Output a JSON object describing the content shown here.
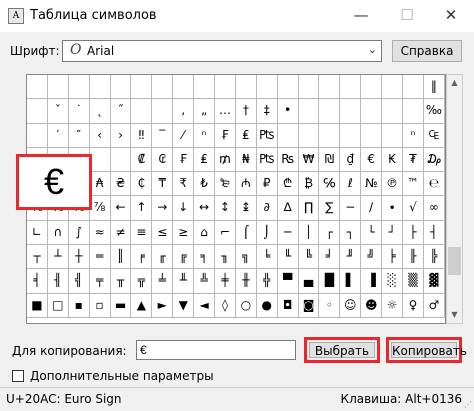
{
  "window": {
    "title": "Таблица символов",
    "app_icon": "char-map-icon",
    "minimize_icon": "—",
    "maximize_icon": "☐",
    "close_icon": "✕"
  },
  "font_row": {
    "label": "Шрифт:",
    "selected_font": "Arial",
    "font_type_icon": "O",
    "help_label": "Справка"
  },
  "grid": {
    "columns": 20,
    "rows": [
      [
        "",
        "",
        "",
        "",
        "",
        "",
        "",
        "",
        "",
        "",
        "",
        "",
        "",
        "",
        "",
        "",
        "",
        "",
        "",
        "‖"
      ],
      [
        "",
        "ˇ",
        "˙",
        "˛",
        "˝",
        "",
        "",
        "‚",
        "„",
        "…",
        "†",
        "‡",
        "•",
        "",
        "",
        "",
        "",
        "",
        "",
        "‰"
      ],
      [
        "",
        "′",
        "″",
        "‹",
        "›",
        "‼",
        "‾",
        "⁄",
        "ⁿ",
        "₣",
        "₤",
        "₧",
        "",
        "",
        "",
        "",
        "",
        "",
        "ⁿ",
        "₠"
      ],
      [
        "",
        "",
        "",
        "",
        "",
        "₡",
        "₢",
        "₣",
        "₤",
        "₥",
        "₦",
        "₧",
        "₨",
        "₩",
        "₪",
        "₫",
        "€",
        "₭",
        "₮",
        "₯"
      ],
      [
        "₰",
        "₱",
        "₲",
        "₳",
        "₴",
        "₵",
        "₸",
        "₹",
        "₺",
        "₻",
        "₼",
        "₽",
        "₾",
        "₿",
        "℅",
        "ℓ",
        "№",
        "℗",
        "™",
        "℮"
      ],
      [
        "⅛",
        "⅜",
        "⅝",
        "⅞",
        "←",
        "↑",
        "→",
        "↓",
        "↔",
        "↕",
        "↨",
        "∂",
        "∆",
        "∏",
        "∑",
        "−",
        "∕",
        "∙",
        "√",
        "∞"
      ],
      [
        "∟",
        "∩",
        "∫",
        "≈",
        "≠",
        "≡",
        "≤",
        "≥",
        "⌂",
        "⌐",
        "⌠",
        "⌡",
        "─",
        "│",
        "┌",
        "┐",
        "└",
        "┘",
        "├",
        "┤"
      ],
      [
        "┬",
        "┴",
        "┼",
        "═",
        "║",
        "╒",
        "╓",
        "╔",
        "╕",
        "╖",
        "╗",
        "╘",
        "╙",
        "╚",
        "╛",
        "╜",
        "╝",
        "╞",
        "╟",
        "╠"
      ],
      [
        "╡",
        "╢",
        "╣",
        "╤",
        "╥",
        "╦",
        "╧",
        "╨",
        "╩",
        "╪",
        "╫",
        "╬",
        "▀",
        "▄",
        "█",
        "▌",
        "▐",
        "░",
        "▒",
        "▓"
      ],
      [
        "■",
        "□",
        "▪",
        "▫",
        "▬",
        "▲",
        "►",
        "▼",
        "◄",
        "◊",
        "○",
        "●",
        "◘",
        "◙",
        "◦",
        "☺",
        "☻",
        "☼",
        "♀",
        "♂"
      ]
    ]
  },
  "preview": {
    "char": "€"
  },
  "scrollbar": {
    "up_icon": "▲",
    "down_icon": "▼"
  },
  "copy_row": {
    "label": "Для копирования:",
    "value": "€",
    "select_label": "Выбрать",
    "copy_label": "Копировать"
  },
  "advanced": {
    "label": "Дополнительные параметры",
    "checked": false
  },
  "status": {
    "left": "U+20AC: Euro Sign",
    "right": "Клавиша: Alt+0136"
  },
  "colors": {
    "highlight": "#e8282d"
  }
}
